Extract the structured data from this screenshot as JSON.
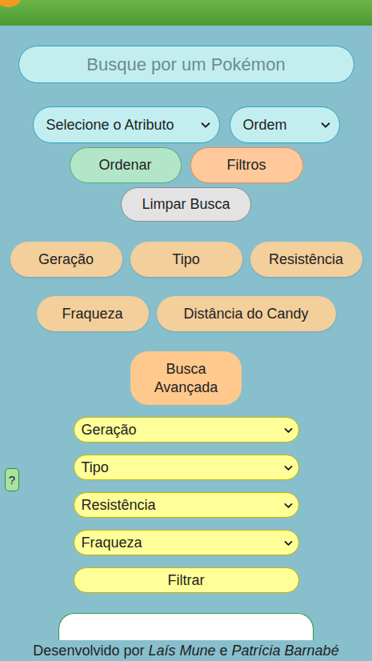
{
  "search": {
    "placeholder": "Busque por um Pokémon"
  },
  "sort": {
    "attribute": "Selecione o Atributo",
    "order": "Ordem"
  },
  "buttons": [
    {
      "label": "Ordenar",
      "color": "#b3e6c9"
    },
    {
      "label": "Filtros",
      "color": "#ffc99b"
    },
    {
      "label": "Limpar Busca",
      "color": "#e3e3e3"
    }
  ],
  "filter_chips": [
    "Geração",
    "Tipo",
    "Resistência",
    "Fraqueza",
    "Distância do Candy"
  ],
  "advanced_button": "Busca Avançada",
  "advanced_filters": [
    "Geração",
    "Tipo",
    "Resistência",
    "Fraqueza"
  ],
  "filter_button": "Filtrar",
  "help_button": "?",
  "footer": {
    "prefix": "Desenvolvido por",
    "author1": "Laís Mune",
    "connector": "e",
    "author2": "Patrícia Barnabé"
  }
}
